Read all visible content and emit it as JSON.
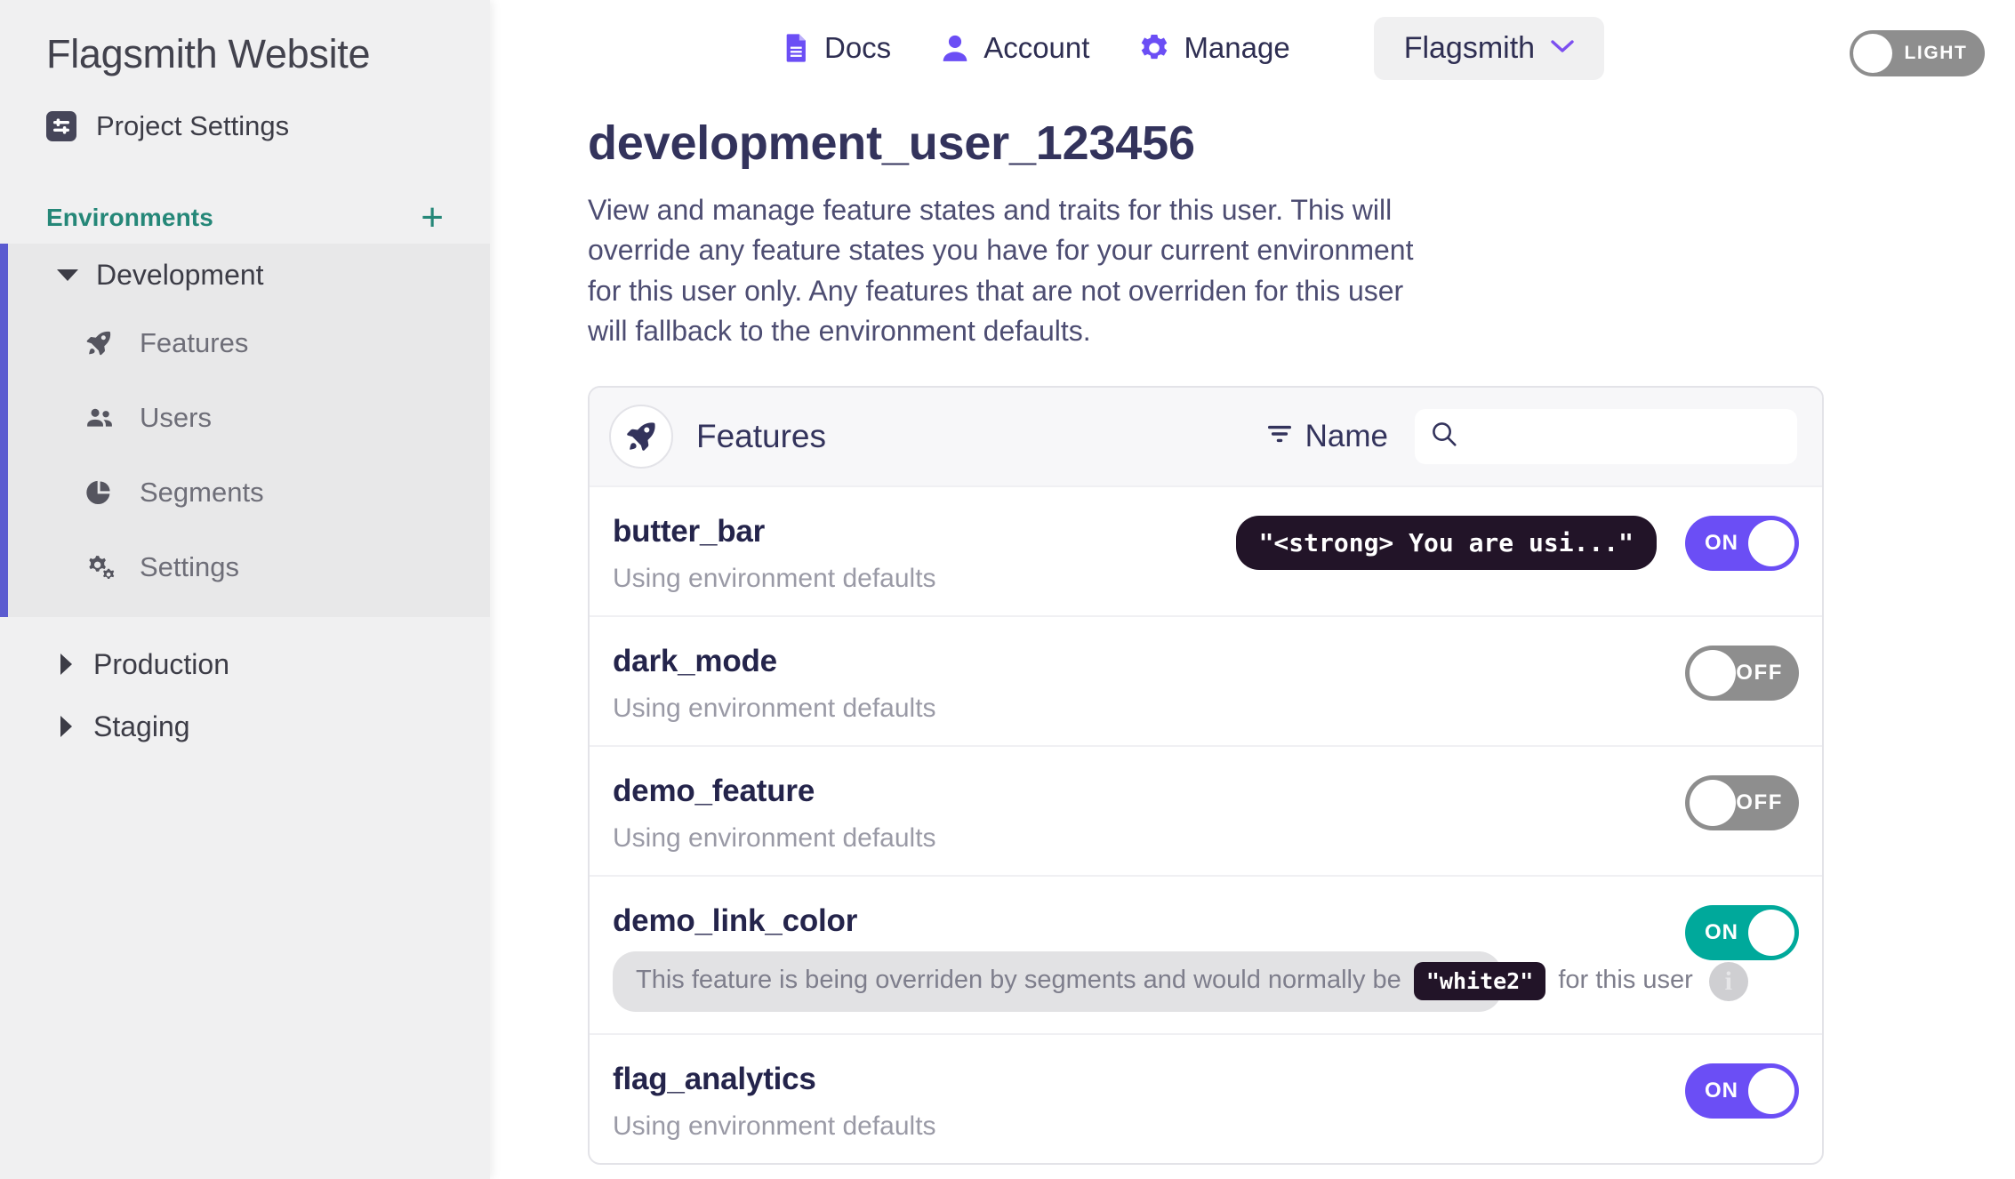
{
  "sidebar": {
    "project_title": "Flagsmith Website",
    "project_settings_label": "Project Settings",
    "project_settings_icon": "sliders-icon",
    "environments_heading": "Environments",
    "environments_add_label": "+",
    "environments": [
      {
        "name": "Development",
        "expanded": true,
        "children": [
          {
            "label": "Features",
            "icon": "rocket-icon"
          },
          {
            "label": "Users",
            "icon": "users-icon"
          },
          {
            "label": "Segments",
            "icon": "pie-chart-icon"
          },
          {
            "label": "Settings",
            "icon": "gears-icon"
          }
        ]
      },
      {
        "name": "Production",
        "expanded": false,
        "children": []
      },
      {
        "name": "Staging",
        "expanded": false,
        "children": []
      }
    ]
  },
  "topnav": {
    "items": [
      {
        "label": "Docs",
        "icon": "document-icon"
      },
      {
        "label": "Account",
        "icon": "user-icon"
      },
      {
        "label": "Manage",
        "icon": "gear-icon"
      }
    ],
    "organisation": "Flagsmith",
    "organisation_caret": "chevron-down-icon",
    "theme_label": "LIGHT",
    "theme_state": "off"
  },
  "page": {
    "title": "development_user_123456",
    "description": "View and manage feature states and traits for this user. This will override any feature states you have for your current environment for this user only. Any features that are not overriden for this user will fallback to the environment defaults."
  },
  "features_panel": {
    "header_icon": "rocket-icon",
    "header_title": "Features",
    "sort_label": "Name",
    "sort_icon": "filter-icon",
    "search_value": "",
    "search_placeholder": "",
    "search_icon": "search-icon",
    "rows": [
      {
        "name": "butter_bar",
        "subtitle": "Using environment defaults",
        "value_pill": "\"<strong> You are usi...\"",
        "toggle_label": "ON",
        "toggle_state": "on",
        "toggle_color": "purple"
      },
      {
        "name": "dark_mode",
        "subtitle": "Using environment defaults",
        "value_pill": "",
        "toggle_label": "OFF",
        "toggle_state": "off",
        "toggle_color": "grey"
      },
      {
        "name": "demo_feature",
        "subtitle": "Using environment defaults",
        "value_pill": "",
        "toggle_label": "OFF",
        "toggle_state": "off",
        "toggle_color": "grey"
      },
      {
        "name": "demo_link_color",
        "override_prefix": "This feature is being overriden by segments and would normally be",
        "override_code": "\"white2\"",
        "override_suffix": "for this user",
        "override_info_icon": "info-icon",
        "toggle_label": "ON",
        "toggle_state": "on",
        "toggle_color": "teal"
      },
      {
        "name": "flag_analytics",
        "subtitle": "Using environment defaults",
        "value_pill": "",
        "toggle_label": "ON",
        "toggle_state": "on",
        "toggle_color": "purple"
      }
    ]
  },
  "colors": {
    "accent_purple": "#6b4ef5",
    "accent_teal": "#00a99b",
    "sidebar_active_bar": "#5b5bd0",
    "environments_heading": "#258778",
    "toggle_off": "#8e8e8e",
    "code_chip_bg": "#221428"
  }
}
